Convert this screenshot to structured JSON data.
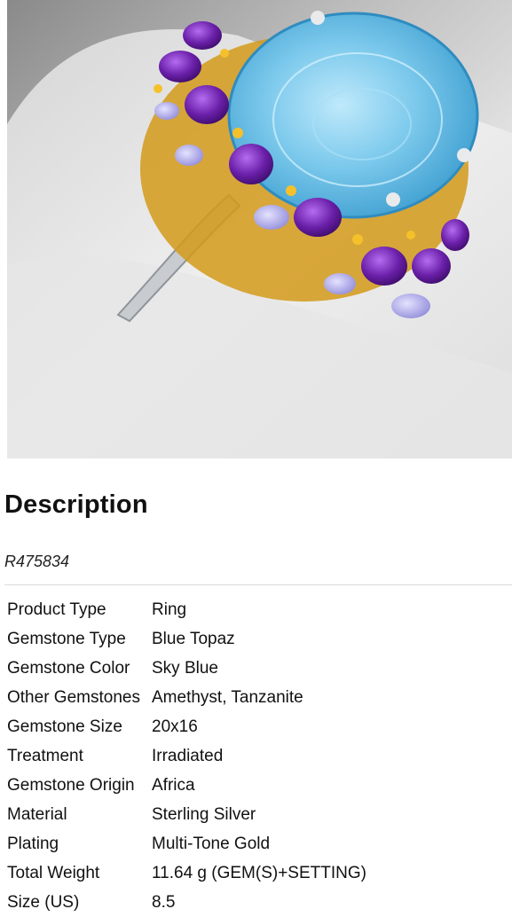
{
  "description": {
    "heading": "Description",
    "sku": "R475834"
  },
  "specs": [
    {
      "label": "Product Type",
      "value": "Ring"
    },
    {
      "label": "Gemstone Type",
      "value": "Blue Topaz"
    },
    {
      "label": "Gemstone Color",
      "value": "Sky Blue"
    },
    {
      "label": "Other Gemstones",
      "value": "Amethyst, Tanzanite"
    },
    {
      "label": "Gemstone Size",
      "value": "20x16"
    },
    {
      "label": "Treatment",
      "value": "Irradiated"
    },
    {
      "label": "Gemstone Origin",
      "value": "Africa"
    },
    {
      "label": "Material",
      "value": "Sterling Silver"
    },
    {
      "label": "Plating",
      "value": "Multi-Tone Gold"
    },
    {
      "label": "Total Weight",
      "value": "11.64 g (GEM(S)+SETTING)"
    },
    {
      "label": "Size (US)",
      "value": "8.5"
    }
  ],
  "colors": {
    "topaz": "#6fc3e8",
    "amethyst": "#6a1fa8",
    "gold": "#e0a21a",
    "silver": "#d8dce0"
  }
}
